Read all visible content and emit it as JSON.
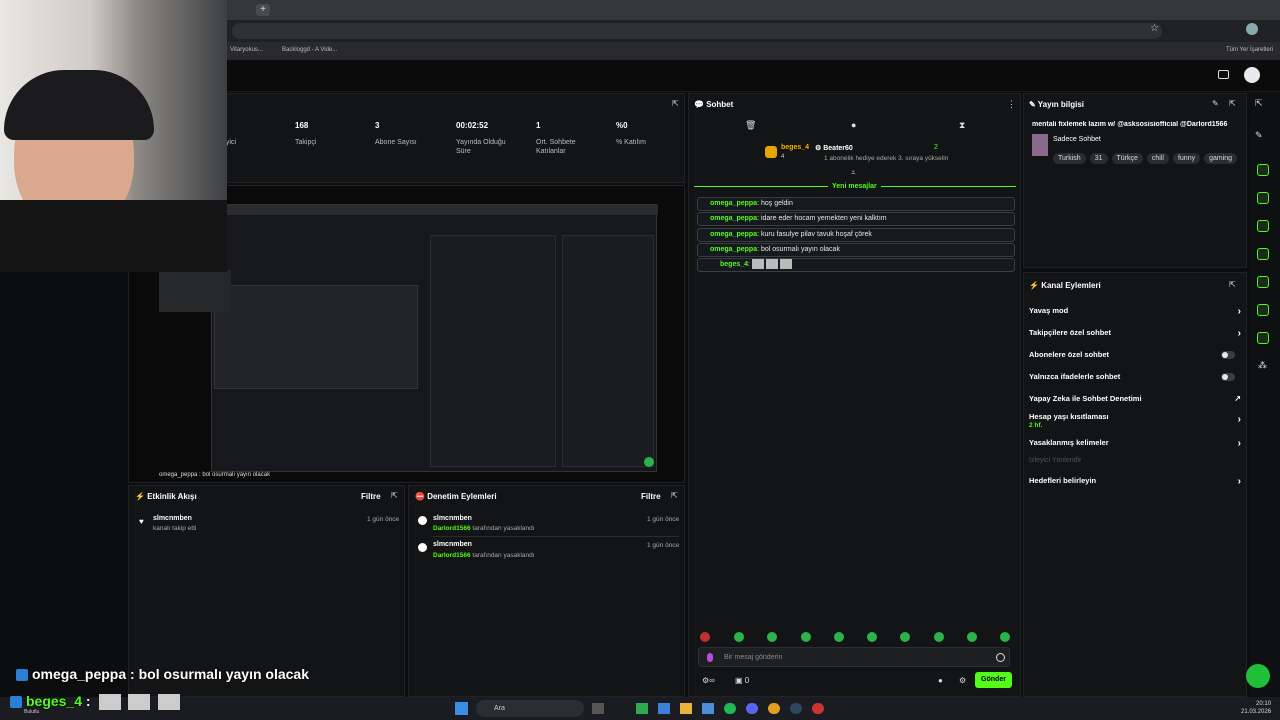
{
  "browser": {
    "bookmarks": [
      "Vitaryokus...",
      "Backloggd - A Vide..."
    ],
    "all_bookmarks": "Tüm Yer İşaretleri"
  },
  "stats": [
    {
      "value": "168",
      "label": "Takipçi"
    },
    {
      "value": "3",
      "label": "Abone Sayısı"
    },
    {
      "value": "00:02:52",
      "label": "Yayında Olduğu Süre"
    },
    {
      "value": "1",
      "label": "Ort. Sohbete Katılanlar"
    },
    {
      "value": "%0",
      "label": "% Katılım"
    }
  ],
  "stats_cut_label": "yici",
  "chat": {
    "title": "Sohbet",
    "pinned_user": "beges_4",
    "pinned_user_count": "4",
    "gifter": "Beater60",
    "gift_count": "2",
    "gift_text": "1 abonelik hediye ederek 3. sıraya yükselin",
    "new_messages": "Yeni mesajlar",
    "messages": [
      {
        "user": "omega_peppa",
        "text": "hoş geldin"
      },
      {
        "user": "omega_peppa",
        "text": "idare eder hocam yemekten yeni kalktım"
      },
      {
        "user": "omega_peppa",
        "text": "kuru fasulye pilav tavuk hoşaf çörek"
      },
      {
        "user": "omega_peppa",
        "text": "bol osurmalı yayın olacak"
      },
      {
        "user": "beges_4",
        "text": ""
      }
    ],
    "input_placeholder": "Bir mesaj gönderin",
    "send_label": "Gönder",
    "viewer_count": "0",
    "infinity": "∞"
  },
  "stream_info": {
    "title": "Yayın bilgisi",
    "stream_title": "mentali fixlemek lazım w/ @asksosisiofficial @Darlord1566",
    "category": "Sadece Sohbet",
    "tags": [
      "Turkish",
      "31",
      "Türkçe",
      "chill",
      "funny",
      "gaming"
    ]
  },
  "channel_actions": {
    "title": "Kanal Eylemleri",
    "items": [
      {
        "label": "Yavaş mod",
        "kind": "arrow"
      },
      {
        "label": "Takipçilere özel sohbet",
        "kind": "arrow"
      },
      {
        "label": "Abonelere özel sohbet",
        "kind": "toggle"
      },
      {
        "label": "Yalnızca ifadelerle sohbet",
        "kind": "toggle"
      },
      {
        "label": "Yapay Zeka ile Sohbet Denetimi",
        "kind": "link"
      },
      {
        "label": "Hesap yaşı kısıtlaması",
        "sub": "2 hf.",
        "kind": "arrow"
      },
      {
        "label": "Yasaklanmış kelimeler",
        "kind": "arrow"
      },
      {
        "label": "İzleyici Yönlendir",
        "kind": "disabled"
      },
      {
        "label": "Hedefleri belirleyin",
        "kind": "arrow"
      }
    ]
  },
  "activity": {
    "title": "Etkinlik Akışı",
    "filter": "Filtre",
    "items": [
      {
        "user": "slmcnmben",
        "text": "kanalı takip etti",
        "time": "1 gün önce"
      }
    ]
  },
  "moderation": {
    "title": "Denetim Eylemleri",
    "filter": "Filtre",
    "items": [
      {
        "user": "slmcnmben",
        "mod": "Darlord1566",
        "text": "tarafından yasaklandı",
        "time": "1 gün önce"
      },
      {
        "user": "slmcnmben",
        "mod": "Darlord1566",
        "text": "tarafından yasaklandı",
        "time": "1 gün önce"
      }
    ]
  },
  "overlay": {
    "line1_user": "omega_peppa",
    "line1_text": "bol osurmalı yayın olacak",
    "line2_user": "beges_4",
    "preview_chat_line": "omega_peppa : bol osurmalı yayın olacak"
  },
  "taskbar": {
    "search": "Ara",
    "time": "20:10",
    "date": "21.03.2026",
    "left_label": "Bulutlu"
  },
  "colors": {
    "accent": "#53fc18",
    "bg": "#0c0d0e",
    "panel": "#131416"
  }
}
